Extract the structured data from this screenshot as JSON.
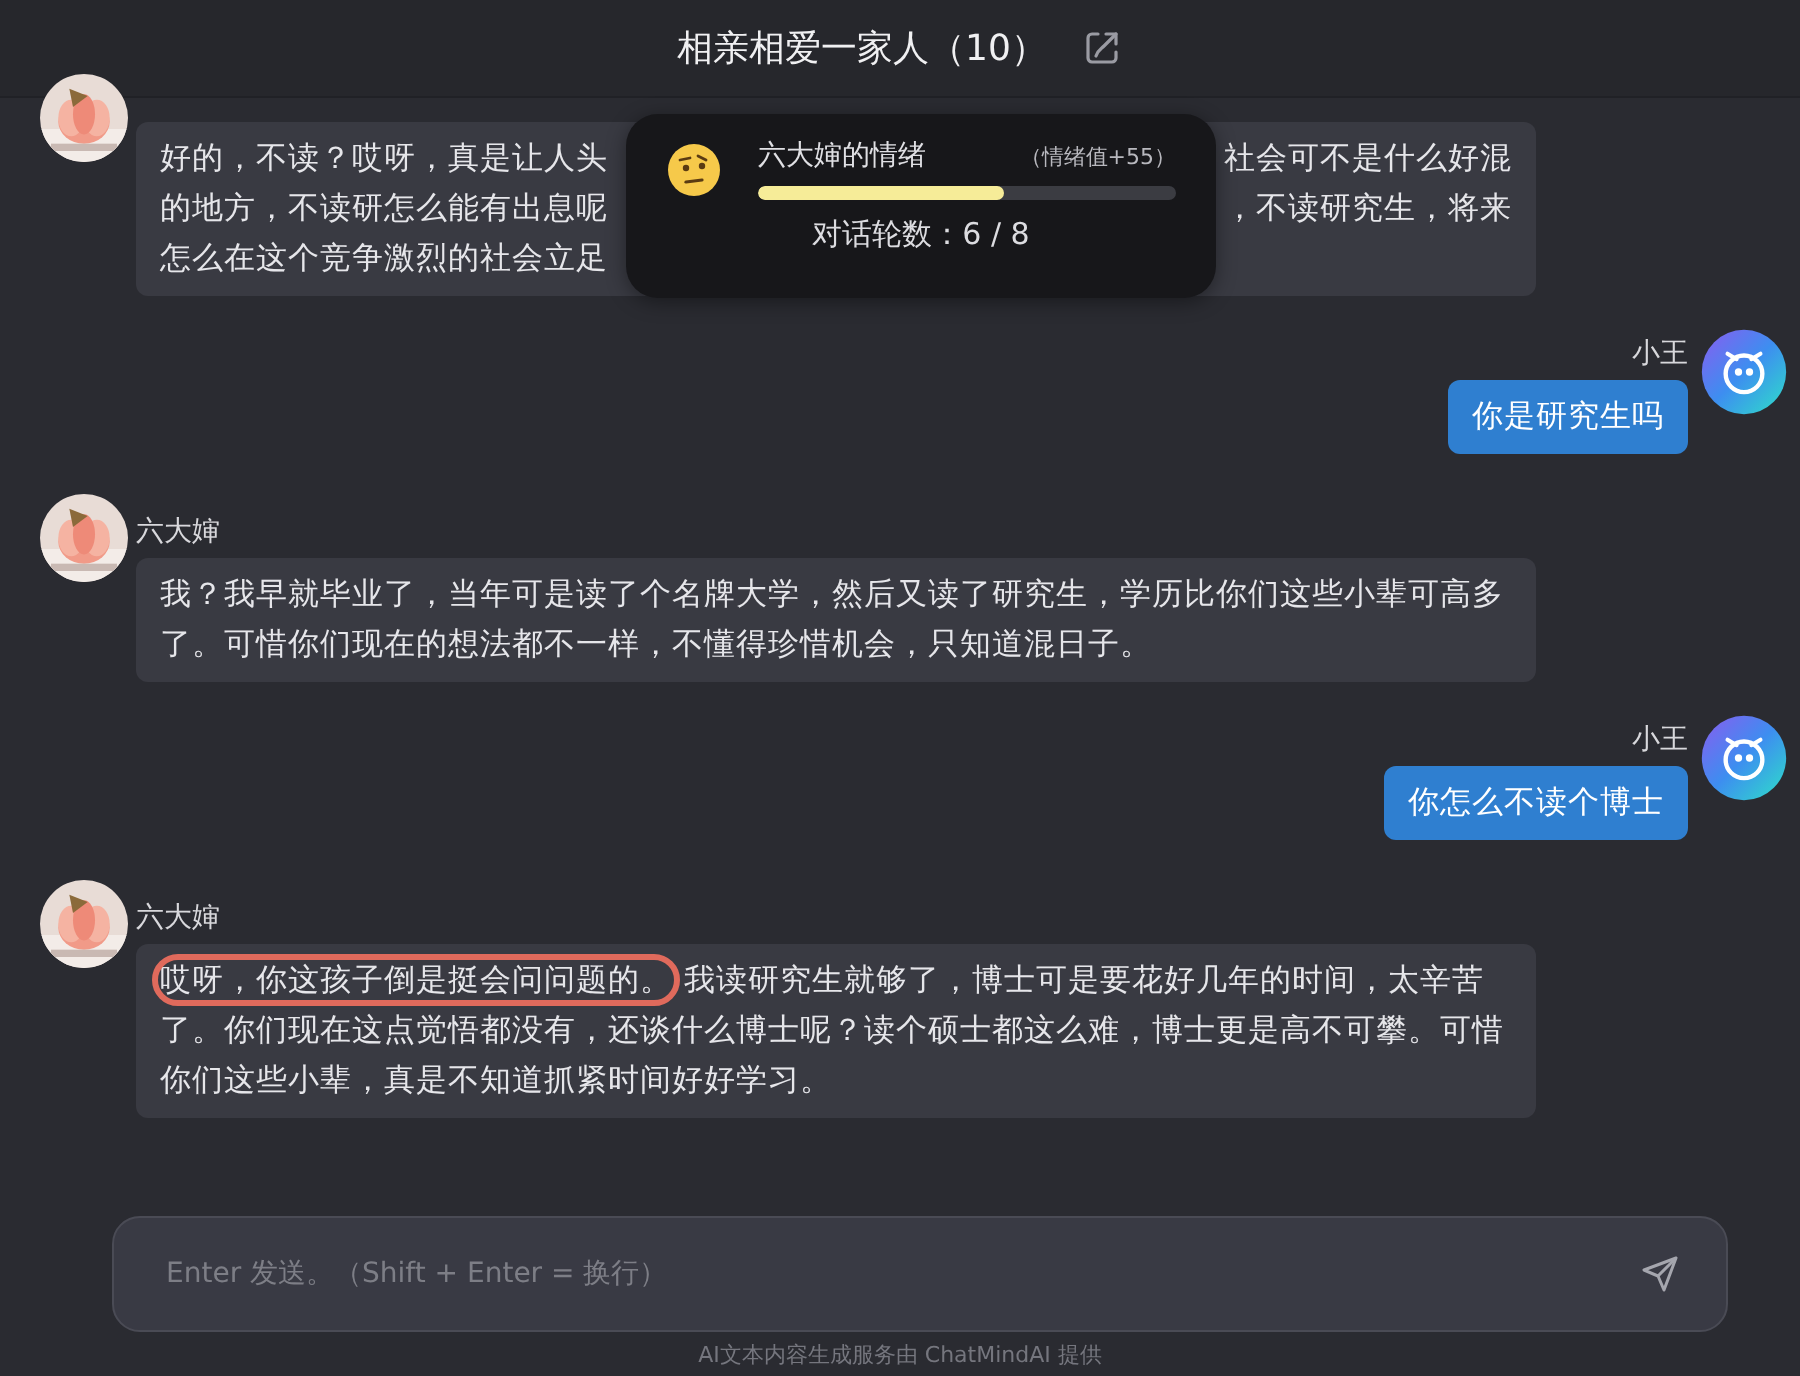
{
  "header": {
    "title": "相亲相爱一家人（10）"
  },
  "mood_popup": {
    "name": "六大婶的情绪",
    "value_label": "（情绪值+55）",
    "level": 0.59,
    "rounds": "对话轮数：6 / 8"
  },
  "messages": [
    {
      "kind": "received",
      "lines": [
        {
          "left": "好的，不读？哎呀，真是让人头",
          "right": "社会可不是什么好混"
        },
        {
          "left": "的地方，不读研怎么能有出息呢",
          "right": "，不读研究生，将来"
        },
        {
          "left": "怎么在这个竞争激烈的社会立足"
        }
      ]
    },
    {
      "kind": "sent",
      "sender": "小王",
      "text": "你是研究生吗"
    },
    {
      "kind": "received",
      "sender": "六大婶",
      "text": "我？我早就毕业了，当年可是读了个名牌大学，然后又读了研究生，学历比你们这些小辈可高多了。可惜你们现在的想法都不一样，不懂得珍惜机会，只知道混日子。"
    },
    {
      "kind": "sent",
      "sender": "小王",
      "text": "你怎么不读个博士"
    },
    {
      "kind": "received",
      "sender": "六大婶",
      "highlight": "哎呀，你这孩子倒是挺会问问题的。",
      "text": "我读研究生就够了，博士可是要花好几年的时间，太辛苦了。你们现在这点觉悟都没有，还谈什么博士呢？读个硕士都这么难，博士更是高不可攀。可惜你们这些小辈，真是不知道抓紧时间好好学习。"
    }
  ],
  "composer": {
    "placeholder": "Enter 发送。（Shift + Enter = 换行）"
  },
  "footer": "AI文本内容生成服务由 ChatMindAI 提供"
}
